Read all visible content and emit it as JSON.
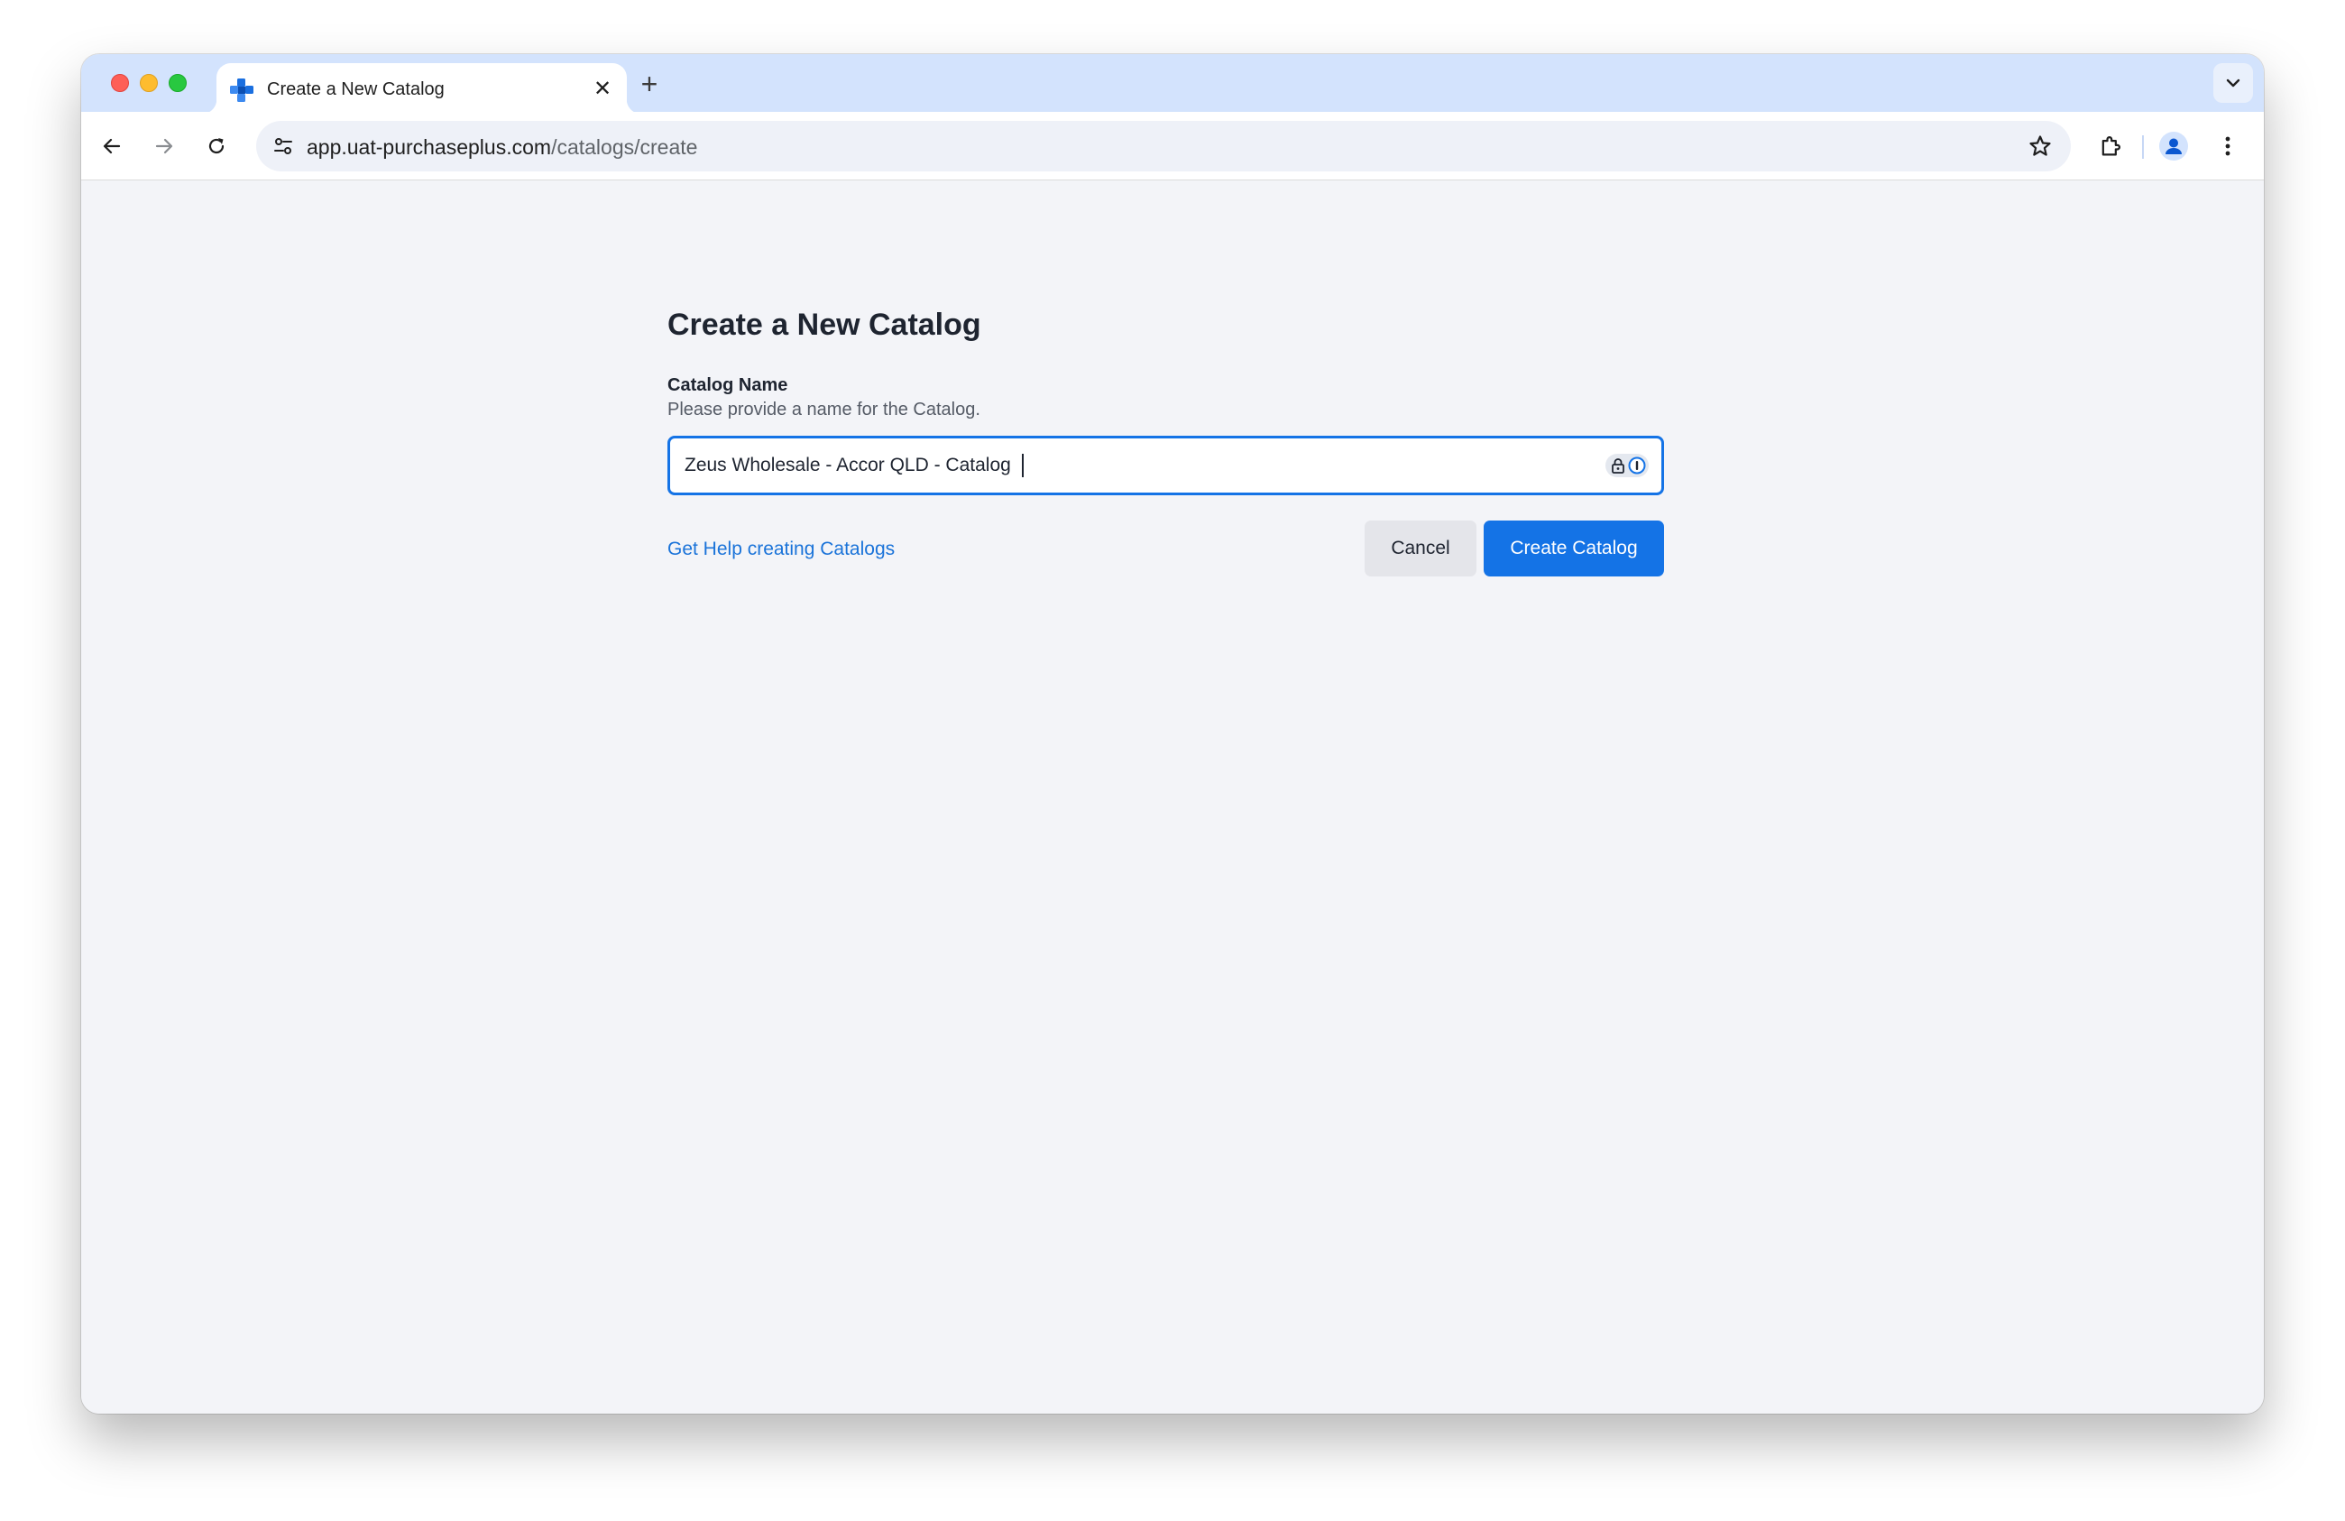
{
  "browser": {
    "tab": {
      "title": "Create a New Catalog",
      "close_glyph": "✕"
    },
    "new_tab_glyph": "+",
    "url": {
      "host": "app.uat-purchaseplus.com",
      "path": "/catalogs/create"
    }
  },
  "page": {
    "title": "Create a New Catalog",
    "field": {
      "label": "Catalog Name",
      "help": "Please provide a name for the Catalog.",
      "value": "Zeus Wholesale - Accor QLD - Catalog"
    },
    "help_link": "Get Help creating Catalogs",
    "cancel_label": "Cancel",
    "create_label": "Create Catalog"
  },
  "colors": {
    "accent": "#1473e6",
    "tabstrip": "#d3e3fd",
    "page_background": "#f3f4f8"
  },
  "icons": {
    "favicon": "catalog-favicon-icon",
    "back": "arrow-left-icon",
    "forward": "arrow-right-icon",
    "reload": "reload-icon",
    "site_settings": "tune-icon",
    "bookmark": "star-icon",
    "extensions": "puzzle-icon",
    "profile": "avatar-icon",
    "menu": "kebab-icon",
    "password_manager": "lock-icon"
  }
}
